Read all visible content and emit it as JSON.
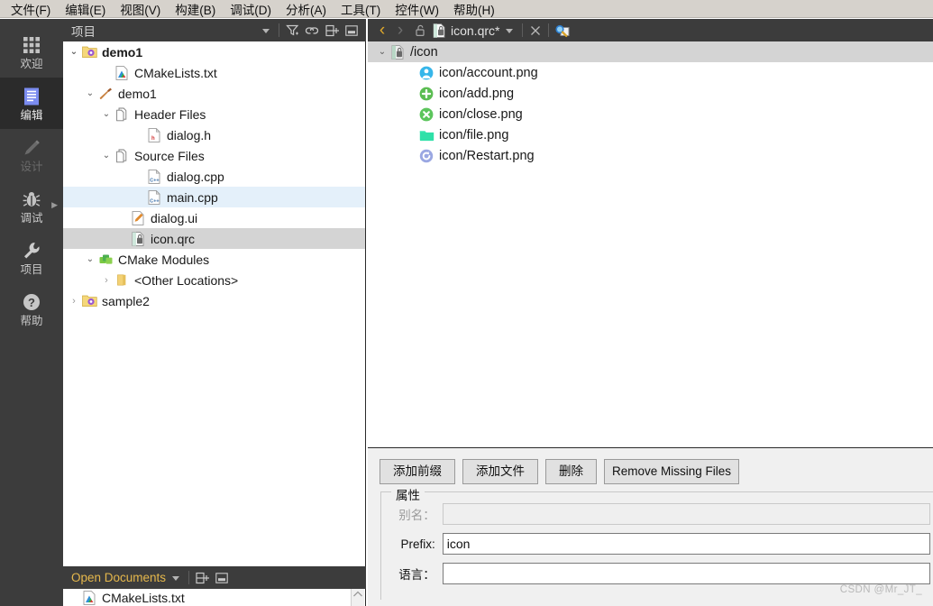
{
  "menubar": {
    "items": [
      {
        "label": "文件(F)",
        "mnemonic": "F"
      },
      {
        "label": "编辑(E)",
        "mnemonic": "E"
      },
      {
        "label": "视图(V)",
        "mnemonic": "V"
      },
      {
        "label": "构建(B)",
        "mnemonic": "B"
      },
      {
        "label": "调试(D)",
        "mnemonic": "D"
      },
      {
        "label": "分析(A)",
        "mnemonic": "A"
      },
      {
        "label": "工具(T)",
        "mnemonic": "T"
      },
      {
        "label": "控件(W)",
        "mnemonic": "W"
      },
      {
        "label": "帮助(H)",
        "mnemonic": "H"
      }
    ]
  },
  "activity_bar": {
    "items": [
      {
        "label": "欢迎",
        "icon": "grid-icon",
        "state": "normal"
      },
      {
        "label": "编辑",
        "icon": "edit-document-icon",
        "state": "selected"
      },
      {
        "label": "设计",
        "icon": "pencil-icon",
        "state": "disabled"
      },
      {
        "label": "调试",
        "icon": "bug-icon",
        "state": "normal",
        "has_arrow": true
      },
      {
        "label": "项目",
        "icon": "wrench-icon",
        "state": "normal"
      },
      {
        "label": "帮助",
        "icon": "question-mark-icon",
        "state": "normal"
      }
    ]
  },
  "project_dock": {
    "title": "项目",
    "toolbar_icons": [
      "chevron-down-icon",
      "filter-icon",
      "link-icon",
      "split-add-icon",
      "minimize-icon"
    ],
    "tree": [
      {
        "label": "demo1",
        "icon": "project-folder-icon",
        "depth": 0,
        "arrow": "open",
        "bold": true,
        "selected": "none"
      },
      {
        "label": "CMakeLists.txt",
        "icon": "cmake-file-icon",
        "depth": 2,
        "arrow": "none",
        "bold": false,
        "selected": "none"
      },
      {
        "label": "demo1",
        "icon": "hammer-icon",
        "depth": 1,
        "arrow": "open",
        "bold": false,
        "selected": "none"
      },
      {
        "label": "Header Files",
        "icon": "folder-files-icon",
        "depth": 2,
        "arrow": "open",
        "bold": false,
        "selected": "none"
      },
      {
        "label": "dialog.h",
        "icon": "header-file-icon",
        "depth": 4,
        "arrow": "none",
        "bold": false,
        "selected": "none"
      },
      {
        "label": "Source Files",
        "icon": "folder-files-icon",
        "depth": 2,
        "arrow": "open",
        "bold": false,
        "selected": "none"
      },
      {
        "label": "dialog.cpp",
        "icon": "cpp-file-icon",
        "depth": 4,
        "arrow": "none",
        "bold": false,
        "selected": "none"
      },
      {
        "label": "main.cpp",
        "icon": "cpp-file-icon",
        "depth": 4,
        "arrow": "none",
        "bold": false,
        "selected": "blue"
      },
      {
        "label": "dialog.ui",
        "icon": "ui-file-icon",
        "depth": 3,
        "arrow": "none",
        "bold": false,
        "selected": "none"
      },
      {
        "label": "icon.qrc",
        "icon": "qrc-file-icon",
        "depth": 3,
        "arrow": "none",
        "bold": false,
        "selected": "gray"
      },
      {
        "label": "CMake Modules",
        "icon": "cmake-modules-icon",
        "depth": 1,
        "arrow": "open",
        "bold": false,
        "selected": "none"
      },
      {
        "label": "<Other Locations>",
        "icon": "folder-icon",
        "depth": 2,
        "arrow": "closed",
        "bold": false,
        "selected": "none"
      },
      {
        "label": "sample2",
        "icon": "project-folder-icon",
        "depth": 0,
        "arrow": "closed",
        "bold": false,
        "selected": "none"
      }
    ]
  },
  "editor_header": {
    "back_label": "‹",
    "forward_label": "›",
    "lock_icon": "unlocked-icon",
    "file_icon": "qrc-file-icon",
    "filename": "icon.qrc*",
    "dropdown_icon": "chevron-down-icon",
    "close_icon": "close-icon",
    "split_icon": "split-editor-icon"
  },
  "resource_tree": {
    "rows": [
      {
        "label": "/icon",
        "icon": "prefix-qrc-icon",
        "depth": 0,
        "arrow": "open",
        "selected": true
      },
      {
        "label": "icon/account.png",
        "icon": "account-png-icon",
        "depth": 2,
        "arrow": "none",
        "selected": false
      },
      {
        "label": "icon/add.png",
        "icon": "add-png-icon",
        "depth": 2,
        "arrow": "none",
        "selected": false
      },
      {
        "label": "icon/close.png",
        "icon": "close-png-icon",
        "depth": 2,
        "arrow": "none",
        "selected": false
      },
      {
        "label": "icon/file.png",
        "icon": "file-png-icon",
        "depth": 2,
        "arrow": "none",
        "selected": false
      },
      {
        "label": "icon/Restart.png",
        "icon": "restart-png-icon",
        "depth": 2,
        "arrow": "none",
        "selected": false
      }
    ]
  },
  "resource_editor": {
    "buttons": [
      {
        "label": "添加前缀",
        "name": "add-prefix-button"
      },
      {
        "label": "添加文件",
        "name": "add-file-button"
      },
      {
        "label": "删除",
        "name": "remove-button"
      },
      {
        "label": "Remove Missing Files",
        "name": "remove-missing-files-button"
      }
    ],
    "group_title": "属性",
    "fields": [
      {
        "label": "别名：",
        "value": "",
        "placeholder": "",
        "disabled": true,
        "name": "alias-field"
      },
      {
        "label": "Prefix:",
        "value": "icon",
        "placeholder": "",
        "disabled": false,
        "name": "prefix-field"
      },
      {
        "label": "语言：",
        "value": "",
        "placeholder": "",
        "disabled": false,
        "name": "language-field"
      }
    ]
  },
  "open_documents": {
    "title": "Open Documents",
    "toolbar_icons": [
      "chevron-down-icon",
      "split-add-icon",
      "minimize-icon"
    ],
    "items": [
      {
        "label": "CMakeLists.txt",
        "icon": "cmake-file-icon"
      }
    ]
  },
  "watermark": {
    "text": "CSDN @Mr_JT_"
  },
  "colors": {
    "dark_chrome": "#3c3c3c",
    "activity_selected": "#2b2b2b",
    "menu_bg": "#d6d2cc",
    "panel_bg": "#f0f0f0",
    "selection_blue": "#e4f0fa",
    "selection_gray": "#d4d4d4",
    "accent_yellow": "#e6b84c",
    "icon_blue": "#3aa7e0",
    "icon_green": "#4caf50",
    "icon_teal": "#2fe0a8",
    "icon_purple": "#8e9bd8"
  }
}
